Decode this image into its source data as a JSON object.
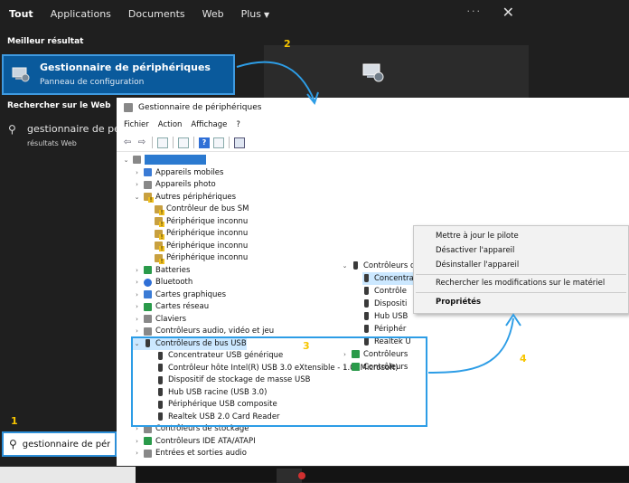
{
  "start_menu": {
    "tabs": [
      {
        "label": "Tout"
      },
      {
        "label": "Applications"
      },
      {
        "label": "Documents"
      },
      {
        "label": "Web"
      },
      {
        "label": "Plus"
      }
    ],
    "more_dots": "···",
    "close": "✕",
    "best_match_label": "Meilleur résultat",
    "best_match_title": "Gestionnaire de périphériques",
    "best_match_subtitle": "Panneau de configuration",
    "web_label": "Rechercher sur le Web",
    "web_query": "gestionnaire de pér",
    "web_sub": "résultats Web",
    "search_value": "gestionnaire de pér"
  },
  "device_manager": {
    "title": "Gestionnaire de périphériques",
    "menu": [
      "Fichier",
      "Action",
      "Affichage",
      "?"
    ],
    "tree": {
      "appareils_mobiles": "Appareils mobiles",
      "appareils_photo": "Appareils photo",
      "autres_peripheriques": "Autres périphériques",
      "autres_children": [
        "Contrôleur de bus SM",
        "Périphérique inconnu",
        "Périphérique inconnu",
        "Périphérique inconnu",
        "Périphérique inconnu"
      ],
      "batteries": "Batteries",
      "bluetooth": "Bluetooth",
      "cartes_graphiques": "Cartes graphiques",
      "cartes_reseau": "Cartes réseau",
      "claviers": "Claviers",
      "audio": "Contrôleurs audio, vidéo et jeu",
      "usb": "Contrôleurs de bus USB",
      "usb_children": [
        "Concentrateur USB générique",
        "Contrôleur hôte Intel(R) USB 3.0 eXtensible - 1.0 (Microsoft)",
        "Dispositif de stockage de masse USB",
        "Hub USB racine (USB 3.0)",
        "Périphérique USB composite",
        "Realtek USB 2.0 Card Reader"
      ],
      "stockage": "Contrôleurs de stockage",
      "ide": "Contrôleurs IDE ATA/ATAPI",
      "audio_io": "Entrées et sorties audio"
    },
    "zoom_tree": {
      "usb": "Contrôleurs de bus USB",
      "children": [
        "Concentrateur USB générique",
        "Contrôle",
        "Dispositi",
        "Hub USB",
        "Périphér",
        "Realtek U"
      ],
      "after": [
        "Contrôleurs",
        "Contrôleurs"
      ]
    }
  },
  "context_menu": {
    "items": [
      "Mettre à jour le pilote",
      "Désactiver l'appareil",
      "Désinstaller l'appareil",
      "Rechercher les modifications sur le matériel",
      "Propriétés"
    ]
  },
  "annotations": {
    "n1": "1",
    "n2": "2",
    "n3": "3",
    "n4": "4"
  },
  "colors": {
    "accent": "#2d9de6",
    "number": "#f7c500",
    "best_match_bg": "#0a5a9c"
  }
}
